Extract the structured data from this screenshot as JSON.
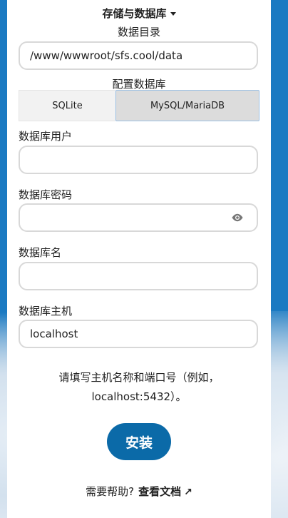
{
  "storage": {
    "title": "存储与数据库",
    "data_dir_label": "数据目录",
    "data_dir_value": "/www/wwwroot/sfs.cool/data",
    "db_config_label": "配置数据库",
    "db_options": [
      "SQLite",
      "MySQL/MariaDB"
    ],
    "selected_db": "MySQL/MariaDB",
    "db_user_label": "数据库用户",
    "db_user_value": "",
    "db_password_label": "数据库密码",
    "db_password_value": "",
    "db_name_label": "数据库名",
    "db_name_value": "",
    "db_host_label": "数据库主机",
    "db_host_value": "localhost",
    "host_hint": "请填写主机名称和端口号（例如，\nlocalhost:5432）。"
  },
  "actions": {
    "install_label": "安装",
    "help_text": "需要帮助?",
    "docs_link": "查看文档",
    "docs_arrow": "↗"
  },
  "icons": {
    "caret": "chevron-down-icon",
    "password_toggle": "eye-icon",
    "external_link": "external-link-icon"
  },
  "colors": {
    "background": "#1b7ac2",
    "primary_button": "#0b6aa8",
    "selected_segment": "#dcdcdc",
    "input_border": "#d8d8d8"
  }
}
